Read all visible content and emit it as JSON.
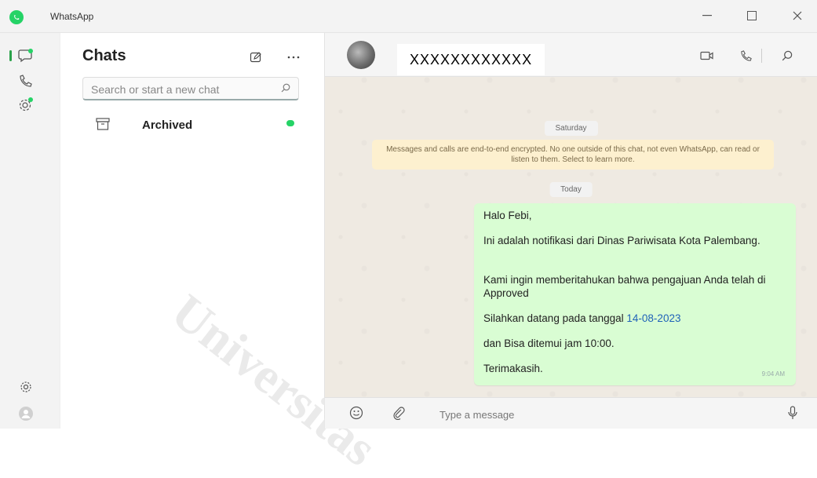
{
  "window": {
    "title": "WhatsApp"
  },
  "chat_list": {
    "title": "Chats",
    "search_placeholder": "Search or start a new chat",
    "archived_label": "Archived"
  },
  "chat": {
    "contact_name": "XXXXXXXXXXXX",
    "day_label_1": "Saturday",
    "encryption_notice": "Messages and calls are end-to-end encrypted. No one outside of this chat, not even WhatsApp, can read or listen to them. Select to learn more.",
    "day_label_2": "Today",
    "message": {
      "line1": "Halo Febi,",
      "line2": "Ini adalah notifikasi dari Dinas Pariwisata Kota Palembang.",
      "line3": "Kami ingin memberitahukan bahwa pengajuan Anda telah di Approved",
      "line4_prefix": "Silahkan datang pada tanggal ",
      "line4_date": "14-08-2023",
      "line5": "dan Bisa ditemui jam 10:00.",
      "line6": "Terimakasih.",
      "time": "9:04 AM"
    },
    "composer_placeholder": "Type a message"
  },
  "watermark": "Universitas",
  "colors": {
    "accent": "#25d366",
    "bubble": "#d9fdd3",
    "notice": "#fdf0cf",
    "link": "#1f62b8"
  },
  "icons": [
    "whatsapp-logo-icon",
    "chats-icon",
    "calls-icon",
    "status-icon",
    "settings-icon",
    "profile-icon",
    "new-chat-icon",
    "more-icon",
    "search-icon",
    "archive-icon",
    "video-call-icon",
    "voice-call-icon",
    "emoji-icon",
    "attach-icon",
    "mic-icon"
  ]
}
